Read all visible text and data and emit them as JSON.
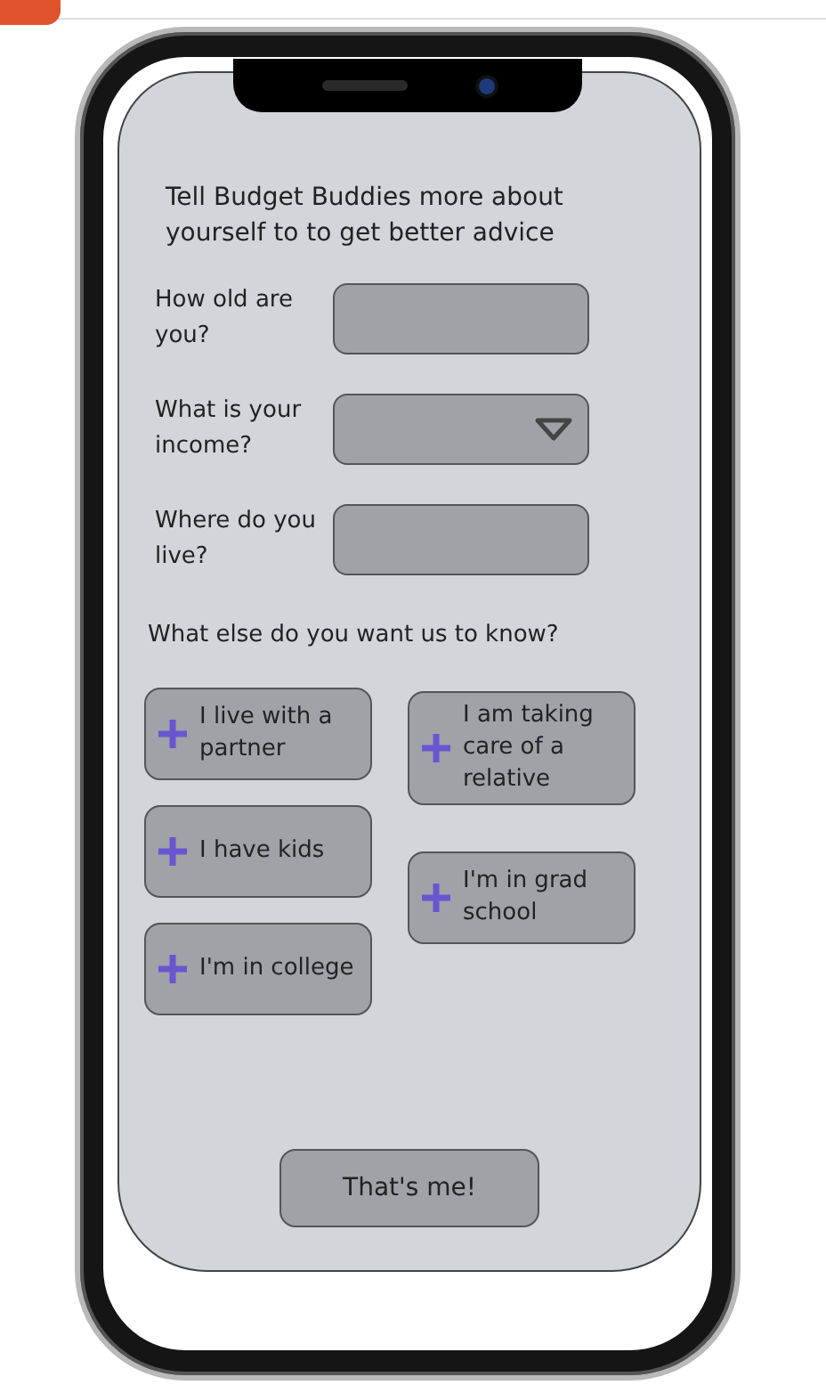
{
  "intro": "Tell Budget Buddies more about yourself to to get better advice",
  "fields": [
    {
      "label": "How old are you?",
      "kind": "text"
    },
    {
      "label": "What is your income?",
      "kind": "dropdown"
    },
    {
      "label": "Where do you live?",
      "kind": "text"
    }
  ],
  "options_heading": "What else do you want us to know?",
  "option_columns": [
    [
      {
        "label": "I live with a partner"
      },
      {
        "label": "I have kids"
      },
      {
        "label": "I'm in college"
      }
    ],
    [
      {
        "label": "I am taking care of a relative"
      },
      {
        "label": "I'm in grad school"
      }
    ]
  ],
  "submit": "That's me!"
}
